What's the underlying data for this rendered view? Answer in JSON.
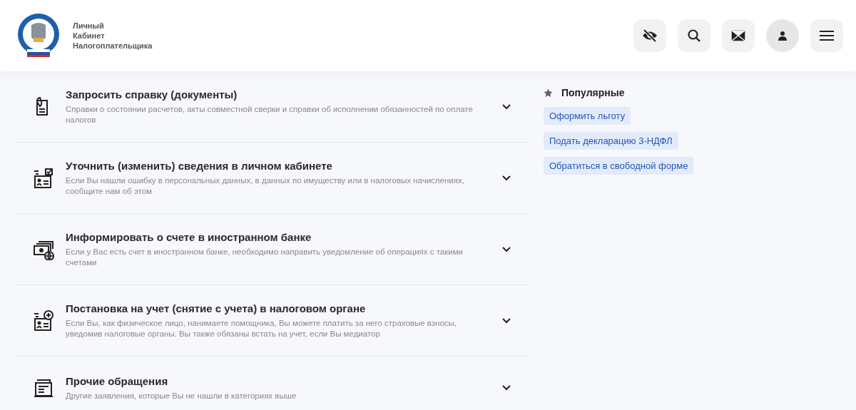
{
  "header": {
    "title_lines": [
      "Личный",
      "Кабинет",
      "Налогоплательщика"
    ],
    "buttons": [
      {
        "kind": "eye",
        "selected": false
      },
      {
        "kind": "search",
        "selected": false
      },
      {
        "kind": "mail",
        "selected": false
      },
      {
        "kind": "user",
        "selected": true
      },
      {
        "kind": "menu",
        "selected": false
      }
    ]
  },
  "services": [
    {
      "kind": "document",
      "title": "Запросить справку (документы)",
      "description": "Справки о состоянии расчетов, акты совместной сверки и справки об исполнении обязанностей по оплате налогов"
    },
    {
      "kind": "edit",
      "title": "Уточнить (изменить) сведения в личном кабинете",
      "description": "Если Вы нашли ошибку в персональных данных, в данных по имуществу или в налоговых начислениях, сообщите нам об этом"
    },
    {
      "kind": "bank",
      "title": "Информировать о счете в иностранном банке",
      "description": "Если у Вас есть счет в иностранном банке, необходимо направить уведомление об операциях с такими счетами"
    },
    {
      "kind": "register",
      "title": "Постановка на учет (снятие с учета) в налоговом органе",
      "description": "Если Вы, как физическое лицо, нанимаете помощника, Вы можете платить за него страховые взносы, уведомив налоговые органы. Вы также обязаны встать на учет, если Вы медиатор"
    },
    {
      "kind": "other",
      "title": "Прочие обращения",
      "description": "Другие заявления, которые Вы не нашли в категориях выше"
    }
  ],
  "popular": {
    "title": "Популярные",
    "links": [
      "Оформить льготу",
      "Подать декларацию 3-НДФЛ",
      "Обратиться в свободной форме"
    ]
  }
}
